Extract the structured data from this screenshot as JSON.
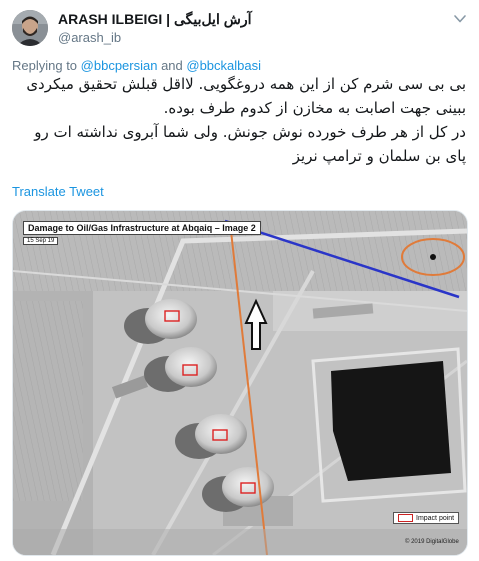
{
  "tweet": {
    "display_name": "ARASH ILBEIGI | آرش ایل‌بیگی",
    "handle": "@arash_ib",
    "reply_prefix": "Replying to ",
    "reply_mention_1": "@bbcpersian",
    "reply_and": " and ",
    "reply_mention_2": "@bbckalbasi",
    "body_paragraph_1": "بی بی سی شرم کن از این همه دروغگویی. لااقل قبلش تحقیق میکردی ببینی جهت اصابت به مخازن از کدوم طرف بوده.",
    "body_paragraph_2": "در کل از هر طرف خورده نوش جونش. ولی شما آبروی نداشته ات رو پای بن سلمان و ترامپ نریز",
    "translate_label": "Translate Tweet"
  },
  "media_image": {
    "title": "Damage to Oil/Gas Infrastructure at Abqaiq – Image 2",
    "date": "15 Sep 19",
    "legend_label": "Impact point",
    "copyright": "© 2019 DigitalGlobe",
    "annotation_colors": {
      "impact_box": "#dd2222",
      "orange_line": "#e07b3a",
      "blue_line": "#2a35c8",
      "arrow": "#111111"
    }
  },
  "icons": {
    "caret": "chevron-down-icon",
    "avatar": "avatar"
  }
}
